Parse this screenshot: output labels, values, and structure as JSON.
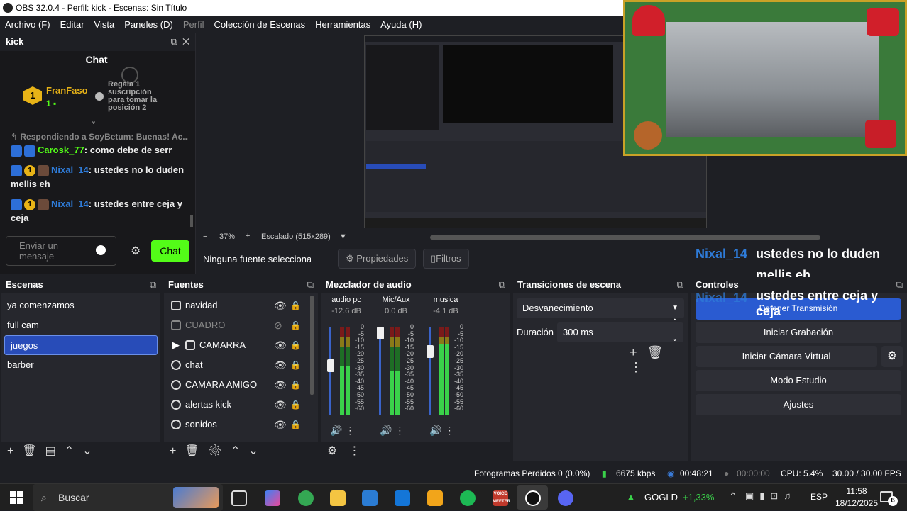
{
  "window": {
    "title": "OBS 32.0.4 - Perfil: kick - Escenas: Sin Título"
  },
  "menu": [
    {
      "label": "Archivo (F)"
    },
    {
      "label": "Editar"
    },
    {
      "label": "Vista"
    },
    {
      "label": "Paneles (D)"
    },
    {
      "label": "Perfil",
      "dim": true
    },
    {
      "label": "Colección de Escenas"
    },
    {
      "label": "Herramientas"
    },
    {
      "label": "Ayuda (H)"
    }
  ],
  "chat_dock": {
    "title": "kick",
    "header": "Chat",
    "gifter": {
      "rank": "1",
      "name": "FranFaso",
      "count": "1",
      "gift_text": "Regala 1 suscripción para tomar la posición 2"
    },
    "reply_to": "Respondiendo a SoyBetum: Buenas! Ac...",
    "messages": [
      {
        "user": "Carosk_77",
        "text": ": como debe de serr"
      },
      {
        "user": "Nixal_14",
        "text": ": ustedes no lo duden mellis eh"
      },
      {
        "user": "Nixal_14",
        "text": ": ustedes entre ceja y ceja"
      }
    ],
    "input_placeholder": "Enviar un mensaje",
    "send_label": "Chat"
  },
  "preview": {
    "zoom": "37%",
    "scale_label": "Escalado (515x289)",
    "no_source": "Ninguna fuente seleccionad",
    "properties_label": "Propiedades",
    "filters_label": "Filtros"
  },
  "overlay_chat": [
    {
      "name": "Nixal_14",
      "text": "ustedes no lo duden mellis eh"
    },
    {
      "name": "Nixal_14",
      "text": "ustedes entre ceja y ceja"
    }
  ],
  "scenes": {
    "title": "Escenas",
    "items": [
      "ya comenzamos",
      "full cam",
      "juegos",
      "barber"
    ],
    "selected_index": 2
  },
  "sources": {
    "title": "Fuentes",
    "items": [
      {
        "name": "navidad",
        "visible": true
      },
      {
        "name": "CUADRO",
        "visible": false
      },
      {
        "name": "CAMARRA",
        "visible": true,
        "group": true
      },
      {
        "name": "chat",
        "visible": true
      },
      {
        "name": "CAMARA AMIGO",
        "visible": true
      },
      {
        "name": "alertas kick",
        "visible": true
      },
      {
        "name": "sonidos",
        "visible": true
      }
    ]
  },
  "mixer": {
    "title": "Mezclador de audio",
    "channels": [
      {
        "name": "audio pc",
        "db": "-12.6 dB",
        "level": 0.55,
        "fader": 0.6
      },
      {
        "name": "Mic/Aux",
        "db": "0.0 dB",
        "level": 0.5,
        "fader": 1.0
      },
      {
        "name": "musica",
        "db": "-4.1 dB",
        "level": 0.8,
        "fader": 0.78
      }
    ],
    "scale": [
      "0",
      "-5",
      "-10",
      "-15",
      "-20",
      "-25",
      "-30",
      "-35",
      "-40",
      "-45",
      "-50",
      "-55",
      "-60"
    ]
  },
  "transitions": {
    "title": "Transiciones de escena",
    "selected": "Desvanecimiento",
    "duration_label": "Duración",
    "duration_value": "300 ms"
  },
  "controls": {
    "title": "Controles",
    "stop_stream": "Detener Transmisión",
    "start_recording": "Iniciar Grabación",
    "virtual_cam": "Iniciar Cámara Virtual",
    "studio_mode": "Modo Estudio",
    "settings": "Ajustes"
  },
  "status": {
    "dropped_frames": "Fotogramas Perdidos 0 (0.0%)",
    "bitrate": "6675 kbps",
    "stream_time": "00:48:21",
    "rec_time": "00:00:00",
    "cpu": "CPU: 5.4%",
    "fps": "30.00 / 30.00 FPS"
  },
  "taskbar": {
    "search_placeholder": "Buscar",
    "stock_name": "GOGLD",
    "stock_change": "+1,33%",
    "lang": "ESP",
    "time": "11:58",
    "date": "18/12/2025",
    "notifications": "6",
    "voice_meeter_label": "VOICE MEETER"
  },
  "colors": {
    "accent": "#2a5bd1",
    "kick_green": "#53fc18",
    "username_blue": "#2e7bd8"
  }
}
